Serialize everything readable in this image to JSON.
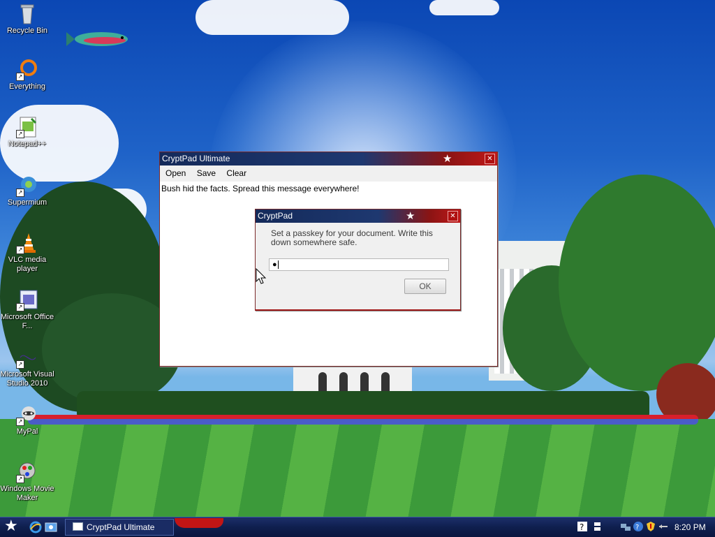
{
  "desktop": {
    "icons": [
      {
        "label": "Recycle Bin"
      },
      {
        "label": "Everything"
      },
      {
        "label": "Notepad++"
      },
      {
        "label": "Supermium"
      },
      {
        "label": "VLC media player"
      },
      {
        "label": "Microsoft Office F..."
      },
      {
        "label": "Microsoft Visual Studio 2010"
      },
      {
        "label": "MyPal"
      },
      {
        "label": "Windows Movie Maker"
      }
    ]
  },
  "main_window": {
    "title": "CryptPad Ultimate",
    "menu": [
      "Open",
      "Save",
      "Clear"
    ],
    "content": "Bush hid the facts. Spread this message everywhere!"
  },
  "dialog": {
    "title": "CryptPad",
    "message": "Set a passkey for your document. Write this down somewhere safe.",
    "passkey_value": "●",
    "ok_label": "OK"
  },
  "taskbar": {
    "task_button_label": "CryptPad Ultimate",
    "clock": "8:20 PM"
  },
  "icons": {
    "start": "star-icon",
    "title_star": "star-icon",
    "close": "close-icon"
  },
  "colors": {
    "titlebar_left": "#142a5a",
    "titlebar_right": "#c01818",
    "taskbar": "#0f1f4e"
  }
}
